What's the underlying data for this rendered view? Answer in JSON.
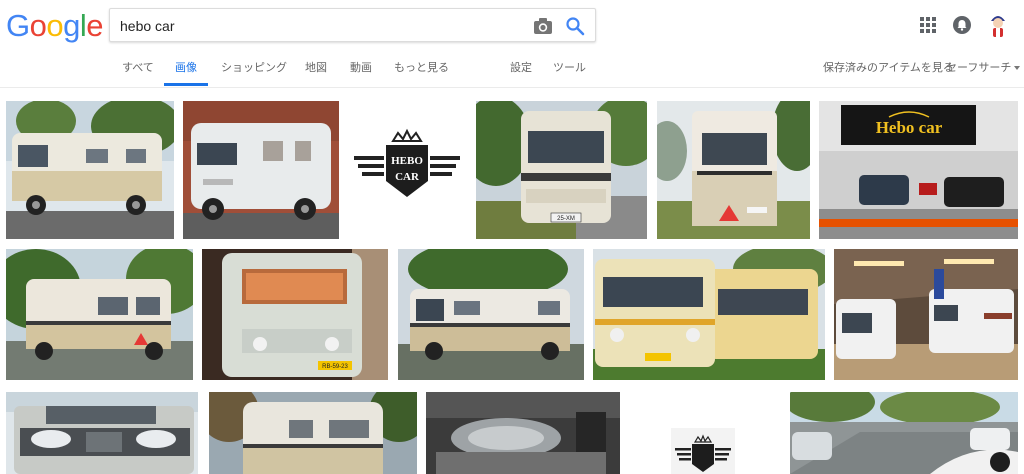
{
  "logo": {
    "letters": [
      "G",
      "o",
      "o",
      "g",
      "l",
      "e"
    ],
    "colors": [
      "#4285f4",
      "#ea4335",
      "#fbbc05",
      "#4285f4",
      "#34a853",
      "#ea4335"
    ]
  },
  "search": {
    "query": "hebo car",
    "camera_icon": "camera-icon",
    "search_icon": "magnifier-icon"
  },
  "header_right": {
    "apps_icon": "apps-grid-icon",
    "notifications_icon": "bell-icon",
    "avatar": "avatar"
  },
  "nav": {
    "all": "すべて",
    "images": "画像",
    "shopping": "ショッピング",
    "maps": "地図",
    "videos": "動画",
    "more": "もっと見る",
    "settings": "設定",
    "tools": "ツール",
    "saved": "保存済みのアイテムを見る",
    "safesearch": "セーフサーチ"
  },
  "logo_tile": {
    "line1": "HEBO",
    "line2": "CAR"
  },
  "showroom_sign": {
    "text": "Hebo car"
  },
  "plates": {
    "r1c4": "25-XM",
    "r2c2": "RB-59-23"
  },
  "colors": {
    "accent": "#1a73e8",
    "nav_text": "#666666",
    "border": "#ebebeb"
  }
}
